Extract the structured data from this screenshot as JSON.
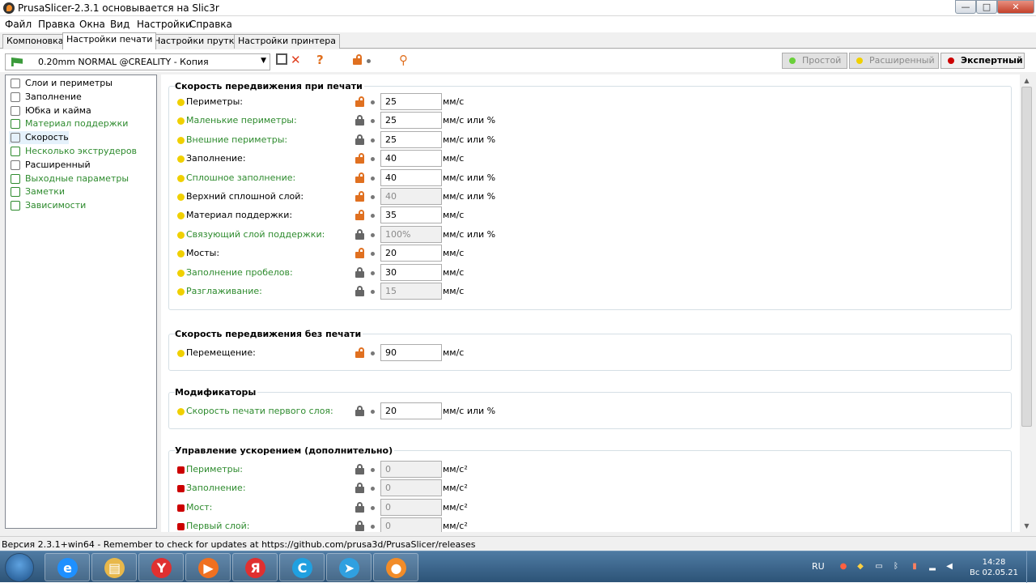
{
  "window": {
    "title": "PrusaSlicer-2.3.1 основывается на Slic3r",
    "controls": {
      "minimize": "—",
      "maximize": "□",
      "close": "✕"
    }
  },
  "menu": [
    "Файл",
    "Правка",
    "Окна",
    "Вид",
    "Настройки",
    "Справка"
  ],
  "tabs": [
    "Компоновка",
    "Настройки печати",
    "Настройки прутка",
    "Настройки принтера"
  ],
  "preset": {
    "name": "0.20mm NORMAL @CREALITY - Копия",
    "flag_color": "#3a9a3a",
    "icons": [
      "save-icon",
      "delete-icon",
      "help-icon",
      "lock-icon",
      "search-icon"
    ]
  },
  "modes": {
    "simple": {
      "label": "Простой",
      "color": "#6ad03a"
    },
    "advanced": {
      "label": "Расширенный",
      "color": "#f0d000"
    },
    "expert": {
      "label": "Экспертный",
      "color": "#cc0000"
    }
  },
  "sidebar": [
    {
      "label": "Слои и периметры",
      "green": false
    },
    {
      "label": "Заполнение",
      "green": false
    },
    {
      "label": "Юбка и кайма",
      "green": false
    },
    {
      "label": "Материал поддержки",
      "green": true
    },
    {
      "label": "Скорость",
      "green": false,
      "selected": true
    },
    {
      "label": "Несколько экструдеров",
      "green": true
    },
    {
      "label": "Расширенный",
      "green": false
    },
    {
      "label": "Выходные параметры",
      "green": true
    },
    {
      "label": "Заметки",
      "green": true
    },
    {
      "label": "Зависимости",
      "green": true
    }
  ],
  "groups": {
    "print_speed": {
      "title": "Скорость передвижения при печати",
      "rows": [
        {
          "label": "Периметры:",
          "value": "25",
          "unit": "мм/с",
          "green": false,
          "open": true,
          "disabled": false
        },
        {
          "label": "Маленькие периметры:",
          "value": "25",
          "unit": "мм/с или %",
          "green": true,
          "open": false,
          "disabled": false
        },
        {
          "label": "Внешние периметры:",
          "value": "25",
          "unit": "мм/с или %",
          "green": true,
          "open": false,
          "disabled": false
        },
        {
          "label": "Заполнение:",
          "value": "40",
          "unit": "мм/с",
          "green": false,
          "open": true,
          "disabled": false
        },
        {
          "label": "Сплошное заполнение:",
          "value": "40",
          "unit": "мм/с или %",
          "green": true,
          "open": true,
          "disabled": false
        },
        {
          "label": "Верхний сплошной слой:",
          "value": "40",
          "unit": "мм/с или %",
          "green": false,
          "open": true,
          "disabled": true
        },
        {
          "label": "Материал поддержки:",
          "value": "35",
          "unit": "мм/с",
          "green": false,
          "open": true,
          "disabled": false
        },
        {
          "label": "Связующий слой поддержки:",
          "value": "100%",
          "unit": "мм/с или %",
          "green": true,
          "open": false,
          "disabled": true
        },
        {
          "label": "Мосты:",
          "value": "20",
          "unit": "мм/с",
          "green": false,
          "open": true,
          "disabled": false
        },
        {
          "label": "Заполнение пробелов:",
          "value": "30",
          "unit": "мм/с",
          "green": true,
          "open": false,
          "disabled": false
        },
        {
          "label": "Разглаживание:",
          "value": "15",
          "unit": "мм/с",
          "green": true,
          "open": false,
          "disabled": true
        }
      ]
    },
    "travel": {
      "title": "Скорость передвижения без печати",
      "rows": [
        {
          "label": "Перемещение:",
          "value": "90",
          "unit": "мм/с",
          "green": false,
          "open": true,
          "disabled": false
        }
      ]
    },
    "modifiers": {
      "title": "Модификаторы",
      "rows": [
        {
          "label": "Скорость печати первого слоя:",
          "value": "20",
          "unit": "мм/с или %",
          "green": true,
          "open": false,
          "disabled": false
        }
      ]
    },
    "acceleration": {
      "title": "Управление ускорением (дополнительно)",
      "rows": [
        {
          "label": "Периметры:",
          "value": "0",
          "unit": "мм/с²",
          "green": true,
          "open": false,
          "disabled": true,
          "red": true
        },
        {
          "label": "Заполнение:",
          "value": "0",
          "unit": "мм/с²",
          "green": true,
          "open": false,
          "disabled": true,
          "red": true
        },
        {
          "label": "Мост:",
          "value": "0",
          "unit": "мм/с²",
          "green": true,
          "open": false,
          "disabled": true,
          "red": true
        },
        {
          "label": "Первый слой:",
          "value": "0",
          "unit": "мм/с²",
          "green": true,
          "open": false,
          "disabled": true,
          "red": true
        }
      ]
    }
  },
  "status": "Версия 2.3.1+win64 - Remember to check for updates at https://github.com/prusa3d/PrusaSlicer/releases",
  "taskbar": {
    "apps": [
      {
        "name": "ie-icon",
        "glyph": "e",
        "color": "#1e90ff"
      },
      {
        "name": "explorer-icon",
        "glyph": "▤",
        "color": "#e8b84a"
      },
      {
        "name": "yandex-browser-icon",
        "glyph": "Y",
        "color": "#e03030"
      },
      {
        "name": "media-player-icon",
        "glyph": "▶",
        "color": "#f07020"
      },
      {
        "name": "yandex-icon",
        "glyph": "Я",
        "color": "#e03030"
      },
      {
        "name": "cura-icon",
        "glyph": "C",
        "color": "#20a0e0"
      },
      {
        "name": "telegram-icon",
        "glyph": "➤",
        "color": "#30a0e0"
      },
      {
        "name": "prusaslicer-icon",
        "glyph": "●",
        "color": "#f28c28"
      }
    ],
    "lang": "RU",
    "time": "14:28",
    "date": "Вс 02.05.21"
  }
}
